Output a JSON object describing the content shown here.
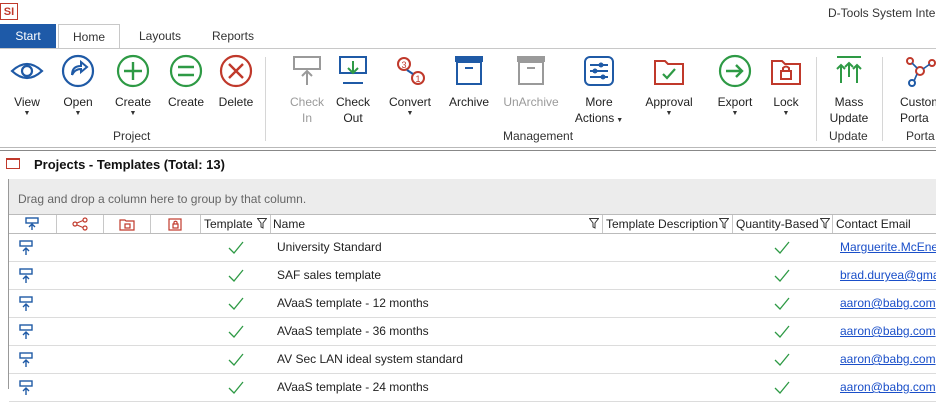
{
  "app": {
    "logo": "SI",
    "title": "D-Tools System Inte"
  },
  "tabs": [
    {
      "label": "Start"
    },
    {
      "label": "Home"
    },
    {
      "label": "Layouts"
    },
    {
      "label": "Reports"
    }
  ],
  "ribbon": {
    "view": "View",
    "open": "Open",
    "create_dropdown": "Create",
    "create": "Create",
    "delete": "Delete",
    "check_in": "Check\nIn",
    "check_out": "Check\nOut",
    "convert": "Convert",
    "archive": "Archive",
    "unarchive": "UnArchive",
    "more_actions": "More\nActions",
    "approval": "Approval",
    "export": "Export",
    "lock": "Lock",
    "mass_update": "Mass\nUpdate",
    "customer_portal": "Custom\nPorta",
    "group_project": "Project",
    "group_management": "Management",
    "group_update": "Update",
    "group_portal": "Porta"
  },
  "panel": {
    "title": "Projects - Templates (Total: 13)"
  },
  "grid": {
    "group_hint": "Drag and drop a column here to group by that column.",
    "columns": {
      "template": "Template",
      "name": "Name",
      "template_description": "Template Description",
      "quantity_based": "Quantity-Based",
      "contact_email": "Contact Email"
    },
    "rows": [
      {
        "name": "University Standard",
        "template": true,
        "quantity_based": true,
        "email": "Marguerite.McEner"
      },
      {
        "name": "SAF sales template",
        "template": true,
        "quantity_based": true,
        "email": "brad.duryea@gmai"
      },
      {
        "name": "AVaaS template - 12 months",
        "template": true,
        "quantity_based": true,
        "email": "aaron@babg.com"
      },
      {
        "name": "AVaaS template - 36 months",
        "template": true,
        "quantity_based": true,
        "email": "aaron@babg.com"
      },
      {
        "name": "AV Sec LAN ideal system standard",
        "template": true,
        "quantity_based": true,
        "email": "aaron@babg.com"
      },
      {
        "name": "AVaaS template - 24 months",
        "template": true,
        "quantity_based": true,
        "email": "aaron@babg.com"
      }
    ]
  },
  "colors": {
    "accent": "#1e5aa8",
    "icon_blue": "#1f5aa6",
    "icon_green": "#2e9a45",
    "icon_red": "#c0392b",
    "disabled": "#9a9a9a",
    "link": "#1a4fc9"
  }
}
